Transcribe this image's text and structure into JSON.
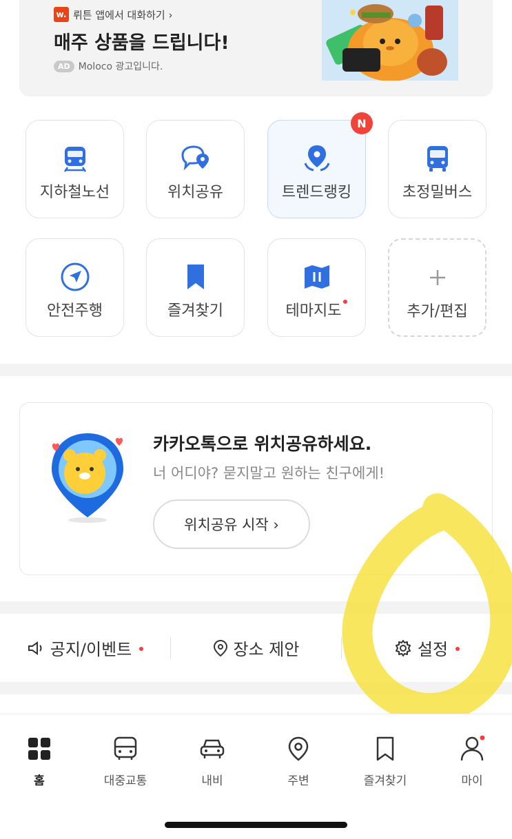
{
  "ad": {
    "brand_logo": "w.",
    "brand_line": "뤼튼 앱에서 대화하기 ›",
    "title": "매주 상품을 드립니다!",
    "badge": "AD",
    "advertiser": "Moloco 광고입니다."
  },
  "shortcuts": [
    {
      "label": "지하철노선",
      "icon": "subway-icon"
    },
    {
      "label": "위치공유",
      "icon": "chat-location-icon"
    },
    {
      "label": "트렌드랭킹",
      "icon": "trend-pin-icon",
      "badge": "N",
      "active": true
    },
    {
      "label": "초정밀버스",
      "icon": "bus-icon"
    },
    {
      "label": "안전주행",
      "icon": "navigation-icon"
    },
    {
      "label": "즐겨찾기",
      "icon": "bookmark-icon"
    },
    {
      "label": "테마지도",
      "icon": "map-icon",
      "new_dot": true
    },
    {
      "label": "추가/편집",
      "icon": "plus-icon"
    }
  ],
  "share": {
    "title": "카카오톡으로 위치공유하세요.",
    "subtitle": "너 어디야? 묻지말고 원하는 친구에게!",
    "button": "위치공유 시작 ›"
  },
  "info": {
    "notice": "공지/이벤트",
    "suggest": "장소 제안",
    "settings": "설정"
  },
  "tabs": [
    {
      "label": "홈",
      "icon": "home-grid-icon",
      "selected": true
    },
    {
      "label": "대중교통",
      "icon": "bus-icon"
    },
    {
      "label": "내비",
      "icon": "car-icon"
    },
    {
      "label": "주변",
      "icon": "location-pin-icon"
    },
    {
      "label": "즐겨찾기",
      "icon": "bookmark-icon"
    },
    {
      "label": "마이",
      "icon": "person-icon",
      "new_dot": true
    }
  ],
  "colors": {
    "accent_blue": "#2f6fe0",
    "red_badge": "#f0443a",
    "highlight_yellow": "#f7e23a"
  }
}
